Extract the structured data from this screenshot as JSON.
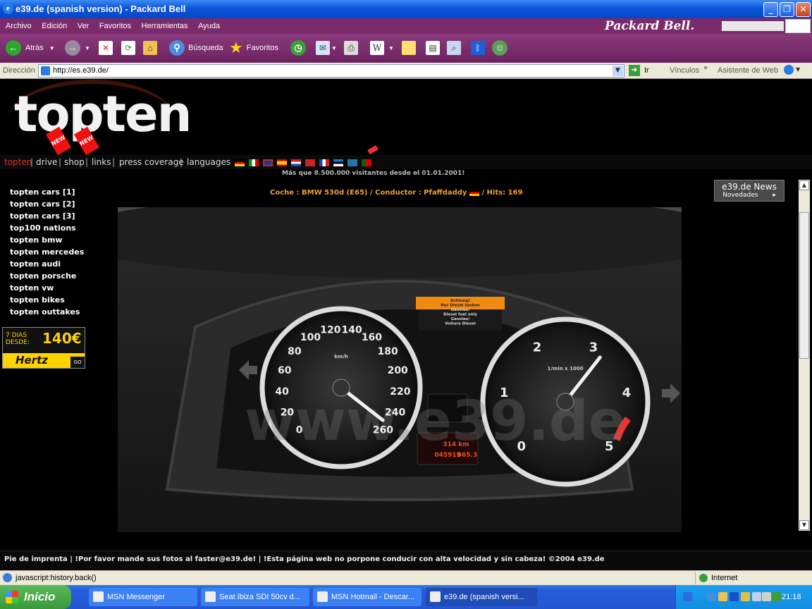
{
  "window": {
    "title": "e39.de (spanish version) - Packard Bell",
    "icon": "ie-icon",
    "buttons": [
      "minimize",
      "maximize",
      "close"
    ]
  },
  "menubar": {
    "items": [
      "Archivo",
      "Edición",
      "Ver",
      "Favoritos",
      "Herramientas",
      "Ayuda"
    ],
    "brand": "Packard Bell."
  },
  "toolbar": {
    "back": "Atrás",
    "search": "Búsqueda",
    "favorites": "Favoritos"
  },
  "address": {
    "label": "Dirección",
    "url": "http://es.e39.de/",
    "go": "Ir",
    "links": "Vínculos",
    "assistant": "Asistente de Web"
  },
  "page": {
    "logo": "topten",
    "new_badge": "NEW",
    "nav": [
      "topten",
      "drive",
      "shop",
      "links",
      "press coverage",
      "languages"
    ],
    "nav_active": "topten",
    "visitors": "Más que 8.500.000 visitantes desde el 01.01.2001!",
    "car_info_left": "Coche : BMW 530d (E65) / Conductor : Pfaffdaddy",
    "car_info_right": "/ Hits: 169",
    "left_menu": [
      "topten cars [1]",
      "topten cars [2]",
      "topten cars [3]",
      "top100 nations",
      "topten bmw",
      "topten mercedes",
      "topten audi",
      "topten porsche",
      "topten vw",
      "topten bikes",
      "topten outtakes"
    ],
    "hertz": {
      "days": "7 DIAS DESDE:",
      "price": "140€",
      "brand": "Hertz",
      "go": "GO"
    },
    "news": {
      "title": "e39.de News",
      "subtitle": "Novedades"
    },
    "watermark": "www.e39.de",
    "speedo_ticks": [
      "0",
      "20",
      "40",
      "60",
      "80",
      "100",
      "120",
      "140",
      "160",
      "180",
      "200",
      "220",
      "240",
      "260"
    ],
    "speedo_unit": "km/h",
    "tacho_ticks": [
      "0",
      "1",
      "2",
      "3",
      "4",
      "5"
    ],
    "tacho_unit": "1/min x 1000",
    "warning": [
      "Achtung!",
      "Nur Diesel tanken",
      "Gasóleo/",
      "Diesel fuel only",
      "Gasoleo/",
      "Voiture Diesel"
    ],
    "odometer": "045919",
    "trip": "865.3",
    "range": "314 km",
    "footer": "Pie de imprenta  |  !Por favor mande sus fotos al faster@e39.de!  |  !Esta página web no porpone conducir con alta velocidad y sin cabeza! ©2004 e39.de"
  },
  "status": {
    "text": "javascript:history.back()",
    "zone": "Internet"
  },
  "taskbar": {
    "start": "Inicio",
    "tasks": [
      "MSN Messenger",
      "Seat Ibiza SDI 50cv d...",
      "MSN Hotmail - Descar...",
      "e39.de (spanish versi..."
    ],
    "active_task": 3,
    "clock": "21:18"
  }
}
